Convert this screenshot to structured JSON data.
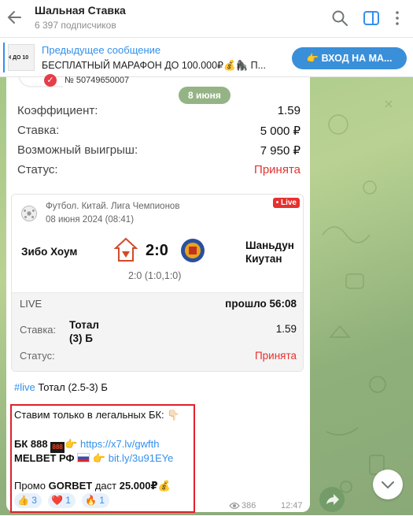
{
  "header": {
    "title": "Шальная Ставка",
    "subtitle": "6 397 подписчиков"
  },
  "pinned": {
    "thumb_text": "Н ДО 10",
    "title": "Предыдущее сообщение",
    "text": "БЕСПЛАТНЫЙ МАРАФОН ДО 100.000₽💰🦍 П...",
    "button": "👉 ВХОД НА МА..."
  },
  "date_pill": "8 июня",
  "receipt": {
    "order_number": "№ 50749650007",
    "rows": [
      {
        "label": "Коэффициент:",
        "value": "1.59"
      },
      {
        "label": "Ставка:",
        "value": "5 000 ₽"
      },
      {
        "label": "Возможный выигрыш:",
        "value": "7 950 ₽"
      },
      {
        "label": "Статус:",
        "value": "Принята"
      }
    ]
  },
  "event": {
    "league": "Футбол. Китай. Лига Чемпионов",
    "date": "08 июня 2024 (08:41)",
    "live_badge": "• Live",
    "team1": "Зибо Хоум",
    "team2_line1": "Шаньдун",
    "team2_line2": "Киутан",
    "score": "2:0",
    "subscore": "2:0 (1:0,1:0)",
    "live_label": "LIVE",
    "elapsed": "прошло 56:08",
    "bet_label": "Ставка:",
    "bet_name_line1": "Тотал",
    "bet_name_line2": "(3) Б",
    "bet_odds": "1.59",
    "status_label": "Статус:",
    "status_value": "Принята"
  },
  "message": {
    "hashtag": "#live",
    "hashtag_rest": " Тотал (2.5-3) Б",
    "legal_line": "Ставим только в легальных БК: 👇🏻",
    "bk888_label": "БК 888",
    "bk888_tag": "888",
    "bk888_link": "https://x7.lv/gwfth",
    "melbet_label": "MELBET РФ",
    "melbet_link": "bit.ly/3u91EYe",
    "promo_prefix": "Промо ",
    "promo_code": "GORBET",
    "promo_middle": " даст ",
    "promo_amount": "25.000₽",
    "promo_emoji": "💰",
    "pointer": "👉"
  },
  "reactions": [
    {
      "emoji": "👍",
      "count": "3"
    },
    {
      "emoji": "❤️",
      "count": "1"
    },
    {
      "emoji": "🔥",
      "count": "1"
    }
  ],
  "meta": {
    "views": "386",
    "time": "12:47"
  },
  "colors": {
    "accent": "#3390ec",
    "accepted_red": "#e5312f",
    "highlight_border": "#e0202a"
  }
}
